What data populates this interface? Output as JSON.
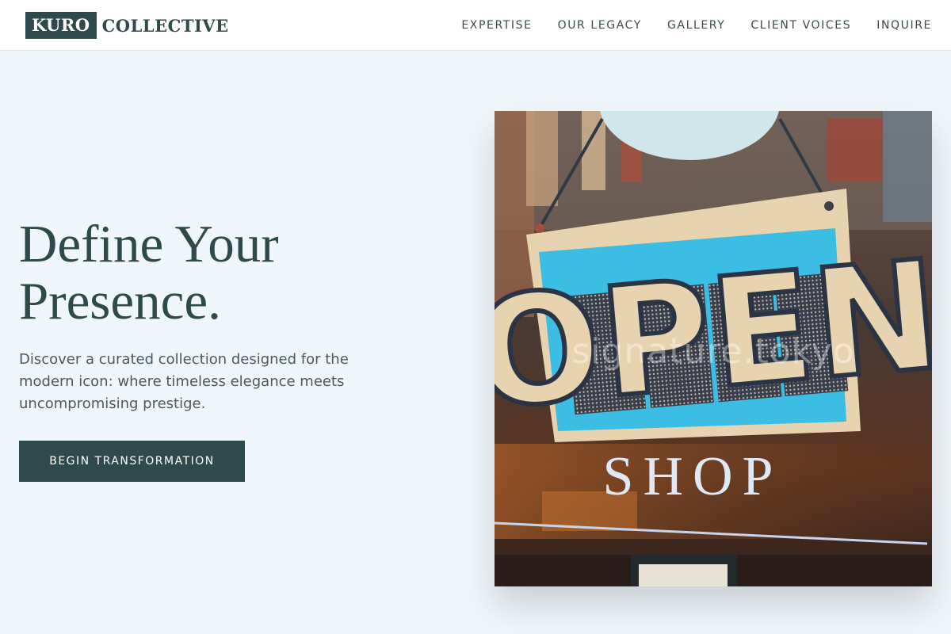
{
  "brand": {
    "mark": "KURO",
    "name": "COLLECTIVE"
  },
  "nav": {
    "items": [
      {
        "label": "EXPERTISE",
        "name": "nav-expertise"
      },
      {
        "label": "OUR LEGACY",
        "name": "nav-our-legacy"
      },
      {
        "label": "GALLERY",
        "name": "nav-gallery"
      },
      {
        "label": "CLIENT VOICES",
        "name": "nav-client-voices"
      },
      {
        "label": "INQUIRE",
        "name": "nav-inquire"
      }
    ]
  },
  "hero": {
    "title_line1": "Define Your",
    "title_line2": "Presence.",
    "subtitle": "Discover a curated collection designed for the modern icon: where timeless elegance meets uncompromising prestige.",
    "cta_label": "BEGIN TRANSFORMATION",
    "image": {
      "sign_text": "OPEN",
      "window_text": "SHOP",
      "watermark": "signature.tokyo"
    }
  }
}
